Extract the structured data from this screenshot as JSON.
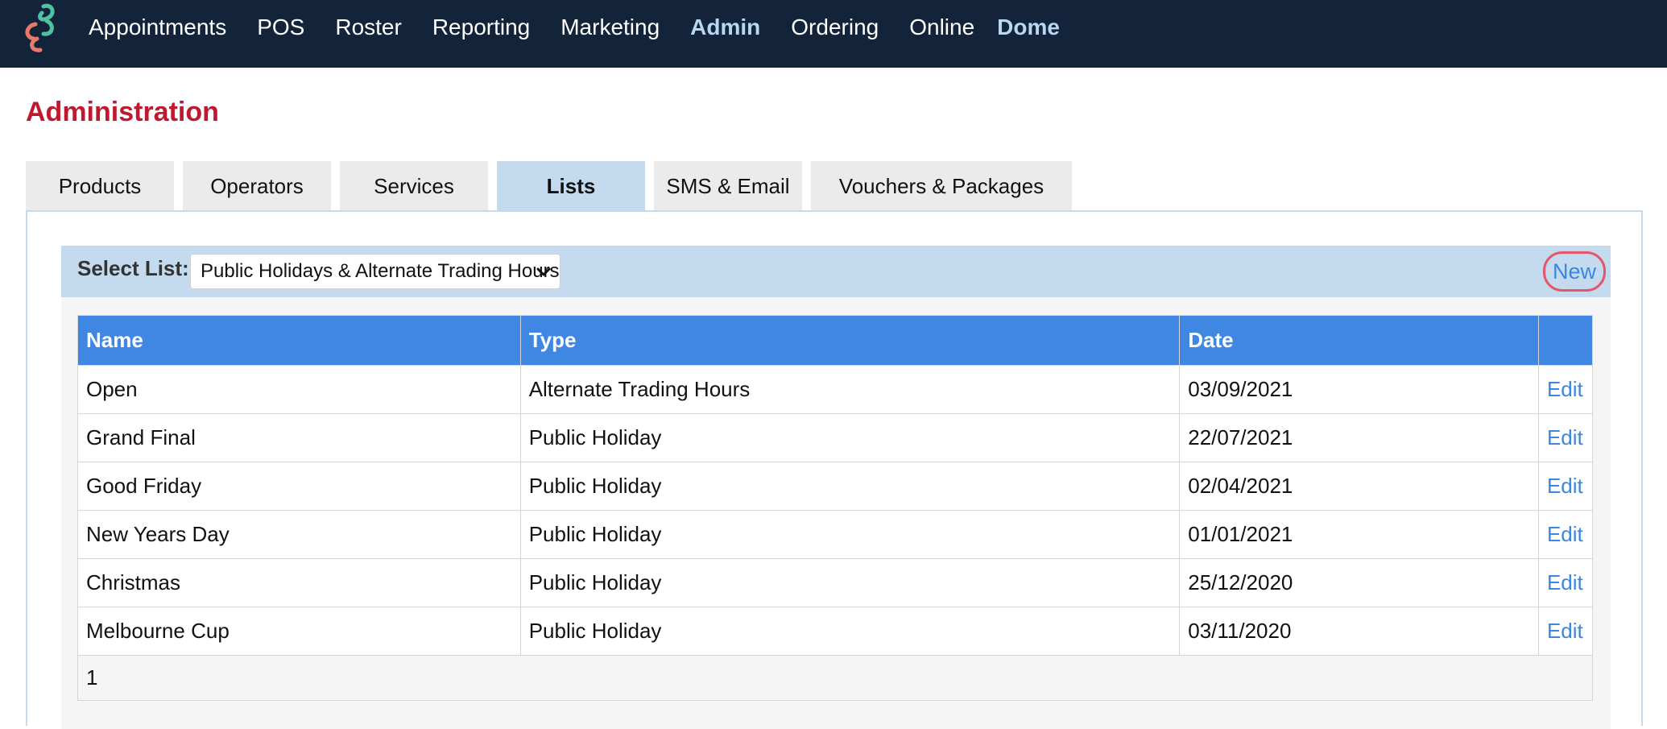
{
  "topnav": {
    "logo_icon": "swirl-logo-icon",
    "items": [
      {
        "label": "Appointments"
      },
      {
        "label": "POS"
      },
      {
        "label": "Roster"
      },
      {
        "label": "Reporting"
      },
      {
        "label": "Marketing"
      },
      {
        "label": "Admin",
        "active": true
      },
      {
        "label": "Ordering"
      },
      {
        "label": "Online"
      },
      {
        "label": "Dome"
      }
    ],
    "colors": {
      "background": "#13243a",
      "active": "#b9d6f2"
    }
  },
  "page": {
    "title": "Administration",
    "title_color": "#c0192f"
  },
  "tabs": [
    {
      "label": "Products"
    },
    {
      "label": "Operators"
    },
    {
      "label": "Services"
    },
    {
      "label": "Lists",
      "active": true
    },
    {
      "label": "SMS & Email"
    },
    {
      "label": "Vouchers & Packages"
    }
  ],
  "list_selector": {
    "label": "Select List:",
    "selected": "Public Holidays & Alternate Trading Hours",
    "new_label": "New"
  },
  "table": {
    "headers": [
      "Name",
      "Type",
      "Date",
      ""
    ],
    "rows": [
      {
        "name": "Open",
        "type": "Alternate Trading Hours",
        "date": "03/09/2021",
        "action": "Edit"
      },
      {
        "name": "Grand Final",
        "type": "Public Holiday",
        "date": "22/07/2021",
        "action": "Edit"
      },
      {
        "name": "Good Friday",
        "type": "Public Holiday",
        "date": "02/04/2021",
        "action": "Edit"
      },
      {
        "name": "New Years Day",
        "type": "Public Holiday",
        "date": "01/01/2021",
        "action": "Edit"
      },
      {
        "name": "Christmas",
        "type": "Public Holiday",
        "date": "25/12/2020",
        "action": "Edit"
      },
      {
        "name": "Melbourne Cup",
        "type": "Public Holiday",
        "date": "03/11/2020",
        "action": "Edit"
      }
    ],
    "page_number": "1",
    "header_color": "#4087e3",
    "link_color": "#3a86e0"
  }
}
